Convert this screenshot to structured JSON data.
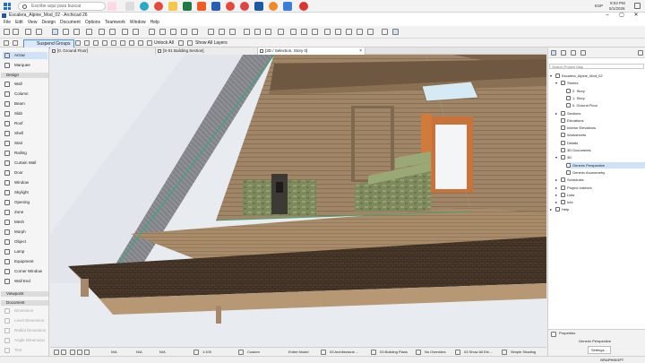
{
  "taskbar": {
    "search_placeholder": "Escribe aquí para buscar",
    "lang": "ESP",
    "time": "9:03 PM",
    "date": "5/1/2026"
  },
  "window": {
    "title": "Escalera_Alpine_Mod_02 - Archicad 26"
  },
  "menu": [
    "File",
    "Edit",
    "View",
    "Design",
    "Document",
    "Options",
    "Teamwork",
    "Window",
    "Help"
  ],
  "toolbar": {
    "suspend_groups": "Suspend Groups",
    "unlock_all": "Unlock All",
    "show_all_layers": "Show All Layers"
  },
  "tabs": [
    {
      "label": "[0. Ground Floor]"
    },
    {
      "label": "[S-01 Building Section]"
    },
    {
      "label": "[3D / Selection, Story 0]"
    }
  ],
  "toolbox": {
    "arrow": "Arrow",
    "marquee": "Marquee",
    "design_header": "Design",
    "design_tools": [
      "Wall",
      "Column",
      "Beam",
      "Slab",
      "Roof",
      "Shell",
      "Stair",
      "Railing",
      "Curtain Wall",
      "Door",
      "Window",
      "Skylight",
      "Opening",
      "Zone",
      "Mesh",
      "Morph",
      "Object",
      "Lamp",
      "Equipment",
      "Corner Window",
      "Wall End"
    ],
    "viewpoint_header": "Viewpoint",
    "document_header": "Document",
    "document_tools": [
      "Dimension",
      "Level Dimension",
      "Radial Dimension",
      "Angle Dimension",
      "Text"
    ]
  },
  "navigator": {
    "search_placeholder": "Search Project Map",
    "tree": [
      {
        "label": "Escalera_Alpine_Mod_02",
        "level": 0,
        "twisty": "▾"
      },
      {
        "label": "Stories",
        "level": 1,
        "twisty": "▾"
      },
      {
        "label": "2. Story",
        "level": 2,
        "twisty": ""
      },
      {
        "label": "1. Story",
        "level": 2,
        "twisty": ""
      },
      {
        "label": "0. Ground Floor",
        "level": 2,
        "twisty": ""
      },
      {
        "label": "Sections",
        "level": 1,
        "twisty": "▸"
      },
      {
        "label": "Elevations",
        "level": 1,
        "twisty": ""
      },
      {
        "label": "Interior Elevations",
        "level": 1,
        "twisty": ""
      },
      {
        "label": "Worksheets",
        "level": 1,
        "twisty": ""
      },
      {
        "label": "Details",
        "level": 1,
        "twisty": ""
      },
      {
        "label": "3D Documents",
        "level": 1,
        "twisty": ""
      },
      {
        "label": "3D",
        "level": 1,
        "twisty": "▾"
      },
      {
        "label": "Generic Perspective",
        "level": 2,
        "twisty": "",
        "selected": true
      },
      {
        "label": "Generic Axonometry",
        "level": 2,
        "twisty": ""
      },
      {
        "label": "Schedules",
        "level": 1,
        "twisty": "▸"
      },
      {
        "label": "Project Indexes",
        "level": 1,
        "twisty": "▸"
      },
      {
        "label": "Lists",
        "level": 1,
        "twisty": "▸"
      },
      {
        "label": "Info",
        "level": 1,
        "twisty": "▸"
      },
      {
        "label": "Help",
        "level": 0,
        "twisty": "▸"
      }
    ],
    "properties_header": "Properties",
    "properties_value": "Generic Perspective",
    "settings_button": "Settings..."
  },
  "statusbar": {
    "n1": "N/A",
    "n2": "N/A",
    "n3": "N/A",
    "scale": "1:100",
    "pen_set": "Custom",
    "model": "Entire Model",
    "layer_combo": "03 Architectural ...",
    "mvo": "03 Building Plans",
    "overrides": "No Overrides",
    "renovation": "03 Show All Ele...",
    "shading": "Simple Shading"
  },
  "brand": "GRAPHISOFT",
  "colors": {
    "accent": "#2f7bd6",
    "selected_bg": "#cfe2f7",
    "toolbox_bg": "#f5f5f5"
  }
}
